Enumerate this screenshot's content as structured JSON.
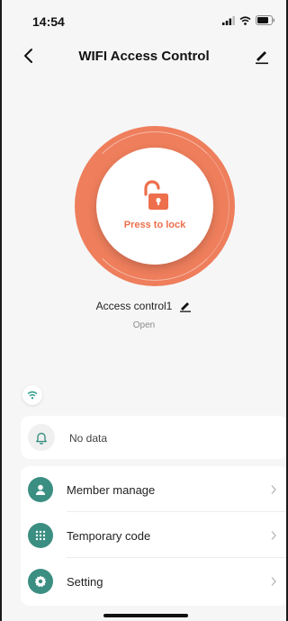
{
  "status_bar": {
    "time": "14:54"
  },
  "nav": {
    "title": "WIFI Access Control",
    "back_icon": "chevron-left-icon",
    "edit_icon": "pencil-icon"
  },
  "lock": {
    "label": "Press to lock",
    "icon": "unlocked-padlock-icon",
    "accent_color": "#ee7e5c"
  },
  "device": {
    "name": "Access control1",
    "status": "Open"
  },
  "alerts": {
    "text": "No data",
    "icon": "bell-icon"
  },
  "menu": {
    "items": [
      {
        "label": "Member manage",
        "icon": "person-icon"
      },
      {
        "label": "Temporary code",
        "icon": "keypad-icon"
      },
      {
        "label": "Setting",
        "icon": "gear-icon"
      }
    ],
    "icon_color": "#3b8f82"
  }
}
